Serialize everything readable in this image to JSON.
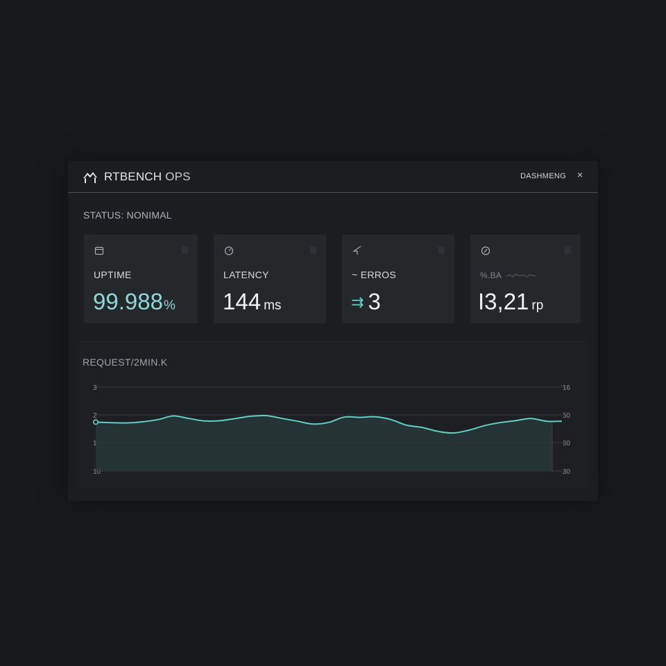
{
  "header": {
    "app_title_bold": "RTBENCH",
    "app_title_light": " OPS",
    "view_label": "DASHMENG",
    "close_glyph": "×"
  },
  "status": "STATUS: NONIMAL",
  "cards": [
    {
      "label": "UPTIME",
      "value": "99.988",
      "unit": "%",
      "icon": "calendar-icon"
    },
    {
      "label": "LATENCY",
      "value": "144",
      "unit": "ms",
      "icon": "gauge-icon"
    },
    {
      "label": "ERROS",
      "label_prefix": "~",
      "value": "3",
      "value_prefix": "⇉",
      "icon": "arrow-icon"
    },
    {
      "label": "%.BA",
      "value": "I3,21",
      "unit": "rp",
      "icon": "clock-icon"
    }
  ],
  "colors": {
    "accent": "#5fd0c8",
    "uptime_value": "#8fd6d8",
    "background": "#17191c",
    "card": "#25282b"
  },
  "chart_data": {
    "type": "area",
    "title": "REQUEST/2MIN.K",
    "left_ticks": [
      "3",
      "2",
      "1",
      "10"
    ],
    "right_ticks": [
      "!16",
      "50",
      "60",
      "30"
    ],
    "grid": true,
    "y": [
      1.75,
      1.73,
      1.72,
      1.76,
      1.84,
      1.97,
      1.88,
      1.79,
      1.8,
      1.88,
      1.96,
      1.98,
      1.88,
      1.78,
      1.68,
      1.74,
      1.93,
      1.92,
      1.94,
      1.84,
      1.64,
      1.56,
      1.42,
      1.36,
      1.46,
      1.62,
      1.73,
      1.8,
      1.88,
      1.78,
      1.78
    ],
    "ylim_left": [
      0,
      3
    ]
  }
}
